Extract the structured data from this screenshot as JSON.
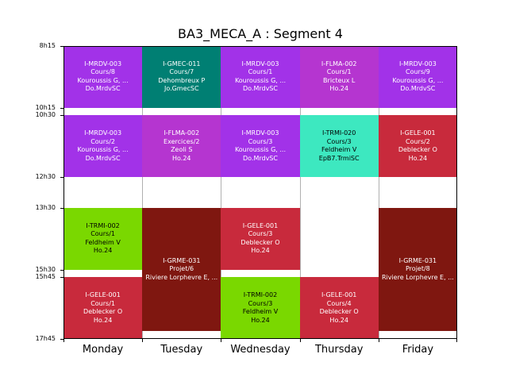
{
  "chart_data": {
    "type": "timetable",
    "title": "BA3_MECA_A : Segment 4",
    "days": [
      "Monday",
      "Tuesday",
      "Wednesday",
      "Thursday",
      "Friday"
    ],
    "time_ticks": [
      "8h15",
      "10h15",
      "10h30",
      "12h30",
      "13h30",
      "15h30",
      "15h45",
      "17h45"
    ],
    "time_range": [
      "8h15",
      "17h45"
    ],
    "grid": true,
    "events": [
      {
        "day": "Monday",
        "start": "8h15",
        "end": "10h15",
        "color": "#a232e8",
        "text_color": "#ffffff",
        "lines": [
          "I-MRDV-003",
          "Cours/8",
          "Kouroussis G, ...",
          "Do.MrdvSC"
        ]
      },
      {
        "day": "Monday",
        "start": "10h30",
        "end": "12h30",
        "color": "#a232e8",
        "text_color": "#ffffff",
        "lines": [
          "I-MRDV-003",
          "Cours/2",
          "Kouroussis G, ...",
          "Do.MrdvSC"
        ]
      },
      {
        "day": "Monday",
        "start": "13h30",
        "end": "15h30",
        "color": "#7ad800",
        "text_color": "#000000",
        "lines": [
          "I-TRMI-002",
          "Cours/1",
          "Feldheim V",
          "Ho.24"
        ]
      },
      {
        "day": "Monday",
        "start": "15h45",
        "end": "17h45",
        "color": "#c82a3c",
        "text_color": "#ffffff",
        "lines": [
          "I-GELE-001",
          "Cours/1",
          "Deblecker O",
          "Ho.24"
        ]
      },
      {
        "day": "Tuesday",
        "start": "8h15",
        "end": "10h15",
        "color": "#007f73",
        "text_color": "#ffffff",
        "lines": [
          "I-GMEC-011",
          "Cours/7",
          "Dehombreux P",
          "Jo.GmecSC"
        ]
      },
      {
        "day": "Tuesday",
        "start": "10h30",
        "end": "12h30",
        "color": "#b535d0",
        "text_color": "#ffffff",
        "lines": [
          "I-FLMA-002",
          "Exercices/2",
          "Zeoli S",
          "Ho.24"
        ]
      },
      {
        "day": "Tuesday",
        "start": "13h30",
        "end": "17h30",
        "color": "#7f1710",
        "text_color": "#ffffff",
        "lines": [
          "I-GRME-031",
          "Projet/6",
          "Riviere Lorphevre E, ..."
        ]
      },
      {
        "day": "Wednesday",
        "start": "8h15",
        "end": "10h15",
        "color": "#a232e8",
        "text_color": "#ffffff",
        "lines": [
          "I-MRDV-003",
          "Cours/1",
          "Kouroussis G, ...",
          "Do.MrdvSC"
        ]
      },
      {
        "day": "Wednesday",
        "start": "10h30",
        "end": "12h30",
        "color": "#a232e8",
        "text_color": "#ffffff",
        "lines": [
          "I-MRDV-003",
          "Cours/3",
          "Kouroussis G, ...",
          "Do.MrdvSC"
        ]
      },
      {
        "day": "Wednesday",
        "start": "13h30",
        "end": "15h30",
        "color": "#c82a3c",
        "text_color": "#ffffff",
        "lines": [
          "I-GELE-001",
          "Cours/3",
          "Deblecker O",
          "Ho.24"
        ]
      },
      {
        "day": "Wednesday",
        "start": "15h45",
        "end": "17h45",
        "color": "#7ad800",
        "text_color": "#000000",
        "lines": [
          "I-TRMI-002",
          "Cours/3",
          "Feldheim V",
          "Ho.24"
        ]
      },
      {
        "day": "Thursday",
        "start": "8h15",
        "end": "10h15",
        "color": "#b535d0",
        "text_color": "#ffffff",
        "lines": [
          "I-FLMA-002",
          "Cours/1",
          "Bricteux L",
          "Ho.24"
        ]
      },
      {
        "day": "Thursday",
        "start": "10h30",
        "end": "12h30",
        "color": "#3de8c0",
        "text_color": "#000000",
        "lines": [
          "I-TRMI-020",
          "Cours/3",
          "Feldheim V",
          "EpB7.TrmiSC"
        ]
      },
      {
        "day": "Thursday",
        "start": "15h45",
        "end": "17h45",
        "color": "#c82a3c",
        "text_color": "#ffffff",
        "lines": [
          "I-GELE-001",
          "Cours/4",
          "Deblecker O",
          "Ho.24"
        ]
      },
      {
        "day": "Friday",
        "start": "8h15",
        "end": "10h15",
        "color": "#a232e8",
        "text_color": "#ffffff",
        "lines": [
          "I-MRDV-003",
          "Cours/9",
          "Kouroussis G, ...",
          "Do.MrdvSC"
        ]
      },
      {
        "day": "Friday",
        "start": "10h30",
        "end": "12h30",
        "color": "#c82a3c",
        "text_color": "#ffffff",
        "lines": [
          "I-GELE-001",
          "Cours/2",
          "Deblecker O",
          "Ho.24"
        ]
      },
      {
        "day": "Friday",
        "start": "13h30",
        "end": "17h30",
        "color": "#7f1710",
        "text_color": "#ffffff",
        "lines": [
          "I-GRME-031",
          "Projet/8",
          "Riviere Lorphevre E, ..."
        ]
      }
    ]
  }
}
